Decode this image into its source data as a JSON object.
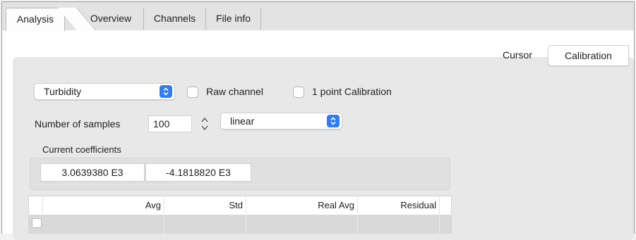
{
  "tabs": [
    {
      "label": "Analysis",
      "active": true
    },
    {
      "label": "Overview",
      "active": false
    },
    {
      "label": "Channels",
      "active": false
    },
    {
      "label": "File info",
      "active": false
    }
  ],
  "subtabs": {
    "cursor": "Cursor",
    "calibration": "Calibration"
  },
  "channel_select": {
    "value": "Turbidity"
  },
  "raw_channel": {
    "label": "Raw channel",
    "checked": false
  },
  "one_point": {
    "label": "1 point Calibration",
    "checked": false
  },
  "samples": {
    "label": "Number of samples",
    "value": "100"
  },
  "fit_select": {
    "value": "linear"
  },
  "coefficients": {
    "label": "Current coefficients",
    "values": [
      "3.0639380 E3",
      "-4.1818820 E3"
    ]
  },
  "table": {
    "columns": [
      "Avg",
      "Std",
      "Real Avg",
      "Residual"
    ],
    "rows": [
      {
        "checked": false,
        "values": [
          "",
          "",
          "",
          ""
        ]
      }
    ]
  },
  "colors": {
    "accent": "#2f7cf6",
    "panel": "#e8e8e8",
    "row": "#d9d9d9"
  }
}
